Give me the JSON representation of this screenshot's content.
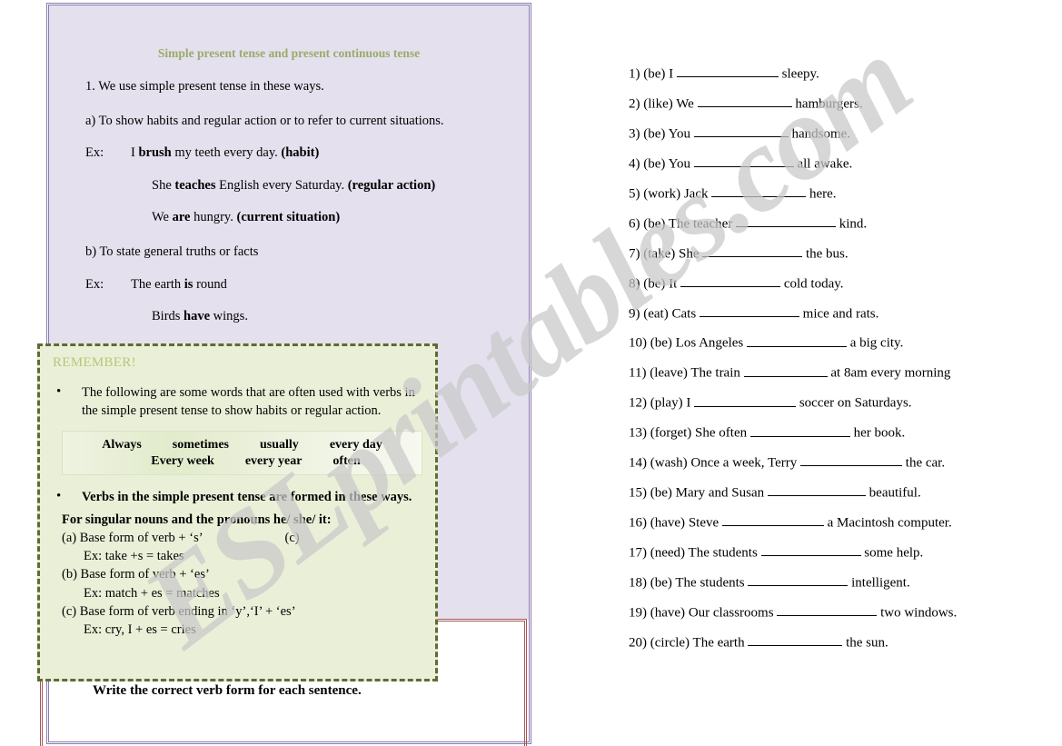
{
  "watermark": {
    "text": "ESLprintables.com"
  },
  "lesson": {
    "title": "Simple present tense and present continuous tense",
    "intro": "1. We use simple present tense in these ways.",
    "point_a": "a) To show habits and regular action or to refer to current situations.",
    "ex_label": "Ex:",
    "example_a1_plain1": "I ",
    "example_a1_bold": "brush",
    "example_a1_plain2": " my teeth every day. ",
    "example_a1_tag": "(habit)",
    "example_a2_plain1": "She ",
    "example_a2_bold": "teaches",
    "example_a2_plain2": " English every Saturday. ",
    "example_a2_tag": "(regular action)",
    "example_a3_plain1": "We ",
    "example_a3_bold": "are",
    "example_a3_plain2": " hungry. ",
    "example_a3_tag": "(current situation)",
    "point_b": "b) To state general truths or facts",
    "example_b1_plain1": "The earth ",
    "example_b1_bold": "is",
    "example_b1_plain2": " round",
    "example_b2_plain1": "Birds ",
    "example_b2_bold": "have",
    "example_b2_plain2": " wings."
  },
  "remember": {
    "title": "REMEMBER!",
    "bullet_dot": "•",
    "bullet1": "The following are some words that are often used with verbs in the simple present tense to show habits or regular action.",
    "word_bank": {
      "row1": [
        "Always",
        "sometimes",
        "usually",
        "every day"
      ],
      "row2": [
        "Every week",
        "every year",
        "often"
      ]
    },
    "bullet2": "Verbs in the simple present tense are formed in these ways.",
    "rule_head": "For singular nouns and the pronouns he/ she/ it:",
    "rule_a": "(a) Base form of verb + ‘s’",
    "rule_a_marker": "(c)",
    "rule_a_ex": "Ex: take +s = takes",
    "rule_b": "(b) Base form of verb + ‘es’",
    "rule_b_ex": "Ex: match + es = matches",
    "rule_c": "(c) Base form of verb ending in ‘y’,‘I’ + ‘es’",
    "rule_c_ex": "Ex: cry, I + es = cries"
  },
  "instruction": "Write the correct verb form for each sentence.",
  "exercises": [
    {
      "num": "1)",
      "verb": "(be)",
      "before": "I",
      "after": "sleepy.",
      "blank_w": 112
    },
    {
      "num": "2)",
      "verb": "(like)",
      "before": "We",
      "after": "hamburgers.",
      "blank_w": 104
    },
    {
      "num": "3)",
      "verb": "(be)",
      "before": "You",
      "after": "handsome.",
      "blank_w": 104
    },
    {
      "num": "4)",
      "verb": "(be)",
      "before": "You",
      "after": "all awake.",
      "blank_w": 110
    },
    {
      "num": "5)",
      "verb": "(work)",
      "before": "Jack",
      "after": "here.",
      "blank_w": 104
    },
    {
      "num": "6)",
      "verb": "(be)",
      "before": "The teacher",
      "after": "kind.",
      "blank_w": 110
    },
    {
      "num": "7)",
      "verb": "(take)",
      "before": "She",
      "after": "the bus.",
      "blank_w": 110
    },
    {
      "num": "8)",
      "verb": "(be)",
      "before": "It",
      "after": "cold today.",
      "blank_w": 110
    },
    {
      "num": "9)",
      "verb": "(eat)",
      "before": "Cats",
      "after": "mice and rats.",
      "blank_w": 110
    },
    {
      "num": "10)",
      "verb": "(be)",
      "before": "Los Angeles",
      "after": "a big city.",
      "blank_w": 110
    },
    {
      "num": "11)",
      "verb": "(leave)",
      "before": "The train",
      "after": "at 8am every morning",
      "blank_w": 92
    },
    {
      "num": "12)",
      "verb": "(play)",
      "before": "I",
      "after": "soccer on Saturdays.",
      "blank_w": 112
    },
    {
      "num": "13)",
      "verb": "(forget)",
      "before": "She often",
      "after": "her book.",
      "blank_w": 110
    },
    {
      "num": "14)",
      "verb": "(wash)",
      "before": "Once a week, Terry",
      "after": "the car.",
      "blank_w": 112
    },
    {
      "num": "15)",
      "verb": "(be)",
      "before": "Mary and Susan",
      "after": "beautiful.",
      "blank_w": 108
    },
    {
      "num": "16)",
      "verb": "(have)",
      "before": "Steve",
      "after": "a Macintosh computer.",
      "blank_w": 112
    },
    {
      "num": "17)",
      "verb": "(need)",
      "before": "The students",
      "after": "some help.",
      "blank_w": 110
    },
    {
      "num": "18)",
      "verb": "(be)",
      "before": "The students",
      "after": "intelligent.",
      "blank_w": 110
    },
    {
      "num": "19)",
      "verb": "(have)",
      "before": "Our classrooms",
      "after": "two windows.",
      "blank_w": 110
    },
    {
      "num": "20)",
      "verb": "(circle)",
      "before": "The earth",
      "after": "the sun.",
      "blank_w": 104
    }
  ],
  "colors": {
    "frame_purple": "#8a7aaf",
    "frame_maroon": "#a85656",
    "panel_bg": "#e4e0ee",
    "remember_bg": "#eaf0d8",
    "remember_border": "#5f6b35",
    "title_green": "#9aab6a",
    "remember_title_green": "#b5c77a",
    "watermark_gray": "#c9c9c9"
  }
}
